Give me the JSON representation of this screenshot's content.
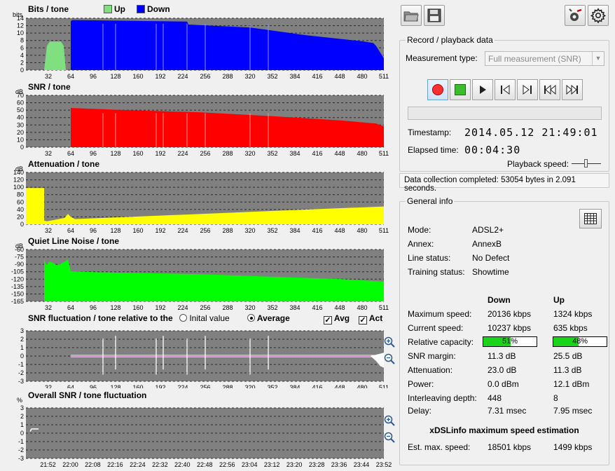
{
  "colors": {
    "up": "#80e080",
    "down": "#0000ff",
    "snr": "#ff0000",
    "attenuation": "#ffff00",
    "qln": "#00ff00",
    "plot_bg": "#808080",
    "grid": "#2a2a2a"
  },
  "charts": {
    "bits": {
      "title": "Bits / tone",
      "unit": "bits",
      "legend_up": "Up",
      "legend_down": "Down",
      "yticks": [
        "14",
        "12",
        "10",
        "8",
        "6",
        "4",
        "2",
        "0"
      ],
      "xticks": [
        "32",
        "64",
        "96",
        "128",
        "160",
        "192",
        "224",
        "256",
        "288",
        "320",
        "352",
        "384",
        "416",
        "448",
        "480",
        "511"
      ]
    },
    "snr": {
      "title": "SNR / tone",
      "unit": "dB",
      "yticks": [
        "70",
        "60",
        "50",
        "40",
        "30",
        "20",
        "10",
        "0"
      ]
    },
    "attenuation": {
      "title": "Attenuation / tone",
      "unit": "dB",
      "yticks": [
        "140",
        "120",
        "100",
        "80",
        "60",
        "40",
        "20",
        "0"
      ]
    },
    "qln": {
      "title": "Quiet Line Noise / tone",
      "unit": "dB",
      "yticks": [
        "-60",
        "-75",
        "-90",
        "-105",
        "-120",
        "-135",
        "-150",
        "-165"
      ]
    },
    "fluct": {
      "title": "SNR fluctuation / tone relative to the",
      "radio_initial": "Inital value",
      "radio_average": "Average",
      "check_avg": "Avg",
      "check_act": "Act",
      "yticks": [
        "3",
        "2",
        "1",
        "0",
        "-1",
        "-2",
        "-3"
      ]
    },
    "overall": {
      "title": "Overall SNR / tone  fluctuation",
      "unit": "%",
      "yticks": [
        "3",
        "2",
        "1",
        "0",
        "-1",
        "-2",
        "-3"
      ],
      "xticks": [
        "21:52",
        "22:00",
        "22:08",
        "22:16",
        "22:24",
        "22:32",
        "22:40",
        "22:48",
        "22:56",
        "23:04",
        "23:12",
        "23:20",
        "23:28",
        "23:36",
        "23:44",
        "23:52"
      ]
    }
  },
  "record": {
    "group_label": "Record / playback data",
    "measurement_type_label": "Measurement type:",
    "measurement_type_value": "Full measurement (SNR)",
    "timestamp_label": "Timestamp:",
    "timestamp_value": "2014.05.12 21:49:01",
    "elapsed_label": "Elapsed time:",
    "elapsed_value": "00:04:30",
    "playback_speed_label": "Playback speed:",
    "status": "Data collection completed: 53054 bytes in 2.091 seconds."
  },
  "general": {
    "group_label": "General info",
    "mode_label": "Mode:",
    "mode_value": "ADSL2+",
    "annex_label": "Annex:",
    "annex_value": "AnnexB",
    "line_status_label": "Line status:",
    "line_status_value": "No Defect",
    "training_label": "Training status:",
    "training_value": "Showtime",
    "col_down": "Down",
    "col_up": "Up",
    "rows": [
      {
        "label": "Maximum speed:",
        "down": "20136 kbps",
        "up": "1324 kbps"
      },
      {
        "label": "Current speed:",
        "down": "10237 kbps",
        "up": "635 kbps"
      },
      {
        "label": "Relative capacity:",
        "down": "51%",
        "up": "48%"
      },
      {
        "label": "SNR margin:",
        "down": "11.3 dB",
        "up": "25.5 dB"
      },
      {
        "label": "Attenuation:",
        "down": "23.0 dB",
        "up": "11.3 dB"
      },
      {
        "label": "Power:",
        "down": "0.0 dBm",
        "up": "12.1 dBm"
      },
      {
        "label": "Interleaving depth:",
        "down": "448",
        "up": "8"
      },
      {
        "label": "Delay:",
        "down": "7.31 msec",
        "up": "7.95 msec"
      }
    ],
    "relative_capacity": {
      "down": 0.51,
      "up": 0.48
    },
    "estimation_title": "xDSLinfo maximum speed estimation",
    "est_label": "Est. max. speed:",
    "est_down": "18501 kbps",
    "est_up": "1499 kbps"
  }
}
